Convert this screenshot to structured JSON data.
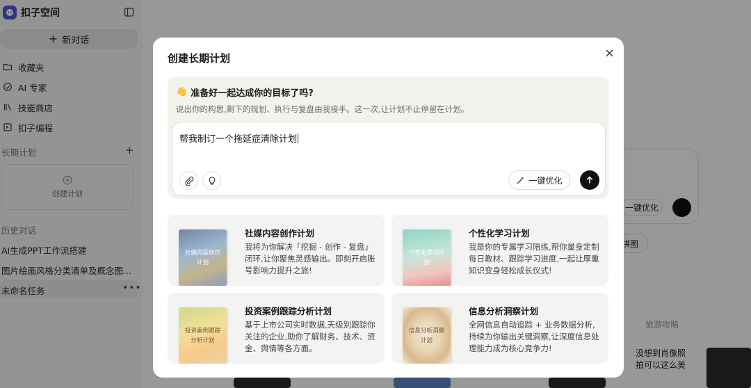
{
  "brand": {
    "name": "扣子空间"
  },
  "sidebar": {
    "new_chat": "新对话",
    "nav": [
      {
        "label": "收藏夹",
        "icon": "folder-icon"
      },
      {
        "label": "AI 专家",
        "icon": "expert-icon"
      },
      {
        "label": "技能商店",
        "icon": "library-icon"
      },
      {
        "label": "扣子编程",
        "icon": "code-icon"
      }
    ],
    "long_term_title": "长期计划",
    "create_plan": "创建计划",
    "history_title": "历史对话",
    "history": [
      "AI生成PPT工作流搭建",
      "图片绘画风格分类清单及概念图...",
      "未命名任务"
    ]
  },
  "background": {
    "optimize": "一键优化",
    "chip": "拼图",
    "tab": "旅游攻略",
    "card_text_1": "没想到肖像照",
    "card_text_2": "拍可以这么美"
  },
  "modal": {
    "title": "创建长期计划",
    "hero_emoji": "👋",
    "hero_heading": "准备好一起达成你的目标了吗?",
    "hero_sub": "说出你的构思,剩下的规划、执行与复盘由我接手。这一次,让计划不止停留在计划。",
    "prompt_value": "帮我制订一个拖延症清除计划",
    "optimize_label": "一键优化",
    "templates": [
      {
        "title": "社媒内容创作计划",
        "cover": "社媒内容创作计划",
        "desc": "我将为你解决「挖掘 - 创作 - 复盘」闭环,让你聚焦灵感输出。即刻开启账号影响力提升之旅!"
      },
      {
        "title": "个性化学习计划",
        "cover": "个性化学习计划",
        "desc": "我是你的专属学习陪练,帮你量身定制每日教材、跟踪学习进度,一起让厚重知识变身轻松成长仪式!"
      },
      {
        "title": "投资案例跟踪分析计划",
        "cover": "投资案例跟踪分析计划",
        "desc": "基于上市公司实时数据,天级别跟踪你关注的企业,助你了解财务、技术、资金、舆情等各方面。"
      },
      {
        "title": "信息分析洞察计划",
        "cover": "信息分析洞察计划",
        "desc": "全网信息自动追踪 + 业务数据分析,持续为你输出关键洞察,让深度信息处理能力成为核心竞争力!"
      }
    ]
  }
}
